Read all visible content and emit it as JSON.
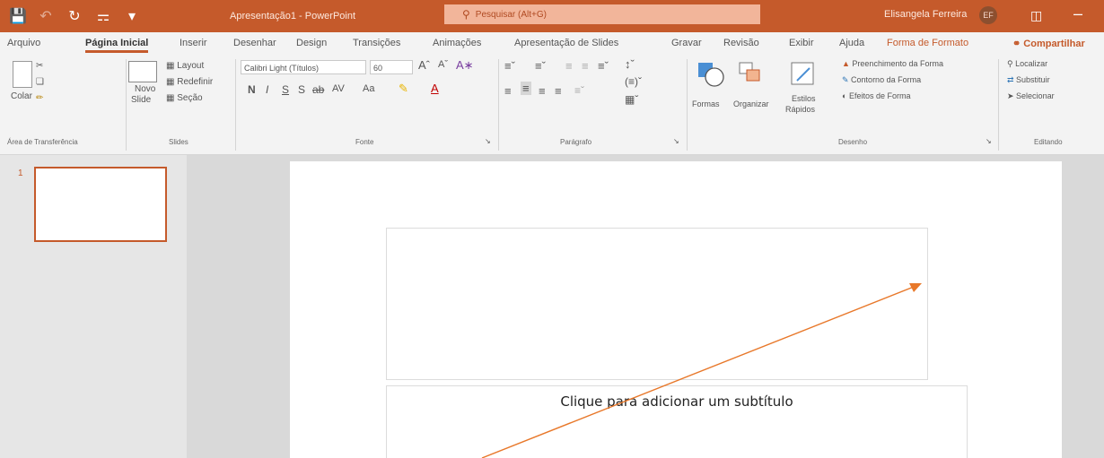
{
  "titlebar": {
    "doc_title": "Apresentação1 - PowerPoint",
    "search_placeholder": "Pesquisar (Alt+G)",
    "user_name": "Elisangela Ferreira",
    "avatar_initials": "EF",
    "accent": "#c55a2b"
  },
  "tabs": [
    "Arquivo",
    "Página Inicial",
    "Inserir",
    "Desenhar",
    "Design",
    "Transições",
    "Animações",
    "Apresentação de Slides",
    "Gravar",
    "Revisão",
    "Exibir",
    "Ajuda",
    "Forma de Formato",
    "Compartilhar"
  ],
  "active_tab": "Página Inicial",
  "ribbon": {
    "clipboard": {
      "paste": "Colar",
      "label": "Área de Transferência"
    },
    "slides": {
      "new_slide_line1": "Novo",
      "new_slide_line2": "Slide",
      "layout": "Layout",
      "reset": "Redefinir",
      "section": "Seção",
      "label": "Slides"
    },
    "font": {
      "name": "Calibri Light (Títulos)",
      "size": "60",
      "bold": "N",
      "italic": "I",
      "underline": "S",
      "strike": "S",
      "spacing": "AV",
      "case": "Aa",
      "label": "Fonte"
    },
    "paragraph": {
      "label": "Parágrafo"
    },
    "drawing": {
      "shapes": "Formas",
      "arrange": "Organizar",
      "quick_styles_line1": "Estilos",
      "quick_styles_line2": "Rápidos",
      "fill": "Preenchimento da Forma",
      "outline": "Contorno da Forma",
      "effects": "Efeitos de Forma",
      "label": "Desenho"
    },
    "editing": {
      "find": "Localizar",
      "replace": "Substituir",
      "select": "Selecionar",
      "label": "Editando"
    }
  },
  "slides_pane": {
    "slide_number": "1"
  },
  "slide": {
    "subtitle_placeholder": "Clique para adicionar um subtítulo"
  }
}
